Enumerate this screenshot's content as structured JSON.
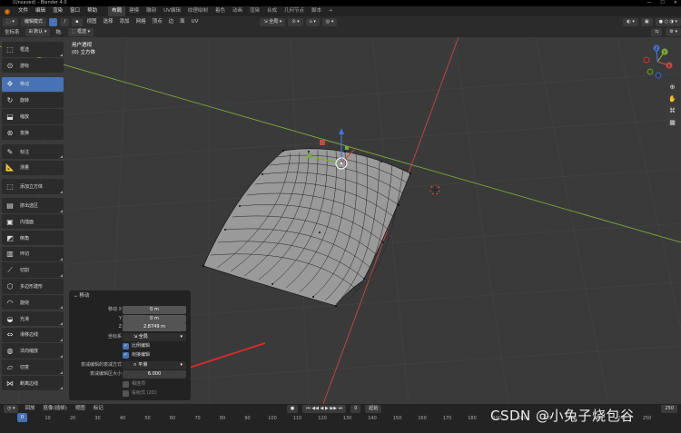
{
  "window": {
    "title": "(Unsaved) - Blender 4.0",
    "controls": [
      "—",
      "☐",
      "✕"
    ]
  },
  "menubar": {
    "menus": [
      "文件",
      "编辑",
      "渲染",
      "窗口",
      "帮助"
    ],
    "workspace_tabs": [
      "布局",
      "建模",
      "雕刻",
      "UV编辑",
      "纹理绘制",
      "着色",
      "动画",
      "渲染",
      "合成",
      "几何节点",
      "脚本",
      "+"
    ],
    "active_tab_index": 0
  },
  "header": {
    "mode": "编辑模式",
    "menus": [
      "视图",
      "选择",
      "添加",
      "网格",
      "顶点",
      "边",
      "面",
      "UV"
    ],
    "transform_orientation": "全局"
  },
  "subheader": {
    "orientation_label": "坐标系",
    "orientation_value": "默认",
    "drag_label": "拖.",
    "drag_value": "框选"
  },
  "toolbar": {
    "tools": [
      {
        "label": "框选",
        "icon": "select-box-icon"
      },
      {
        "label": "游标",
        "icon": "cursor-icon"
      },
      {
        "label": "移动",
        "icon": "move-icon",
        "active": true
      },
      {
        "label": "旋转",
        "icon": "rotate-icon"
      },
      {
        "label": "缩放",
        "icon": "scale-icon"
      },
      {
        "label": "变换",
        "icon": "transform-icon"
      },
      {
        "label": "标注",
        "icon": "annotate-icon"
      },
      {
        "label": "测量",
        "icon": "measure-icon"
      },
      {
        "label": "添加立方体",
        "icon": "add-cube-icon"
      },
      {
        "label": "挤出选区",
        "icon": "extrude-icon"
      },
      {
        "label": "内插面",
        "icon": "inset-icon"
      },
      {
        "label": "倒角",
        "icon": "bevel-icon"
      },
      {
        "label": "环切",
        "icon": "loop-cut-icon"
      },
      {
        "label": "切割",
        "icon": "knife-icon"
      },
      {
        "label": "多边形建形",
        "icon": "poly-build-icon"
      },
      {
        "label": "旋绕",
        "icon": "spin-icon"
      },
      {
        "label": "光滑",
        "icon": "smooth-icon"
      },
      {
        "label": "滑移边线",
        "icon": "edge-slide-icon"
      },
      {
        "label": "法向缩放",
        "icon": "shrink-fatten-icon"
      },
      {
        "label": "切变",
        "icon": "shear-icon"
      },
      {
        "label": "断离边线",
        "icon": "rip-icon"
      }
    ]
  },
  "viewport": {
    "view_name": "用户透视",
    "object_name": "(0) 立方体"
  },
  "gizmo_axes": [
    "X",
    "Y",
    "Z"
  ],
  "operator_panel": {
    "title": "移动",
    "move_x_label": "移动 X",
    "move_x": "0 m",
    "move_y_label": "Y",
    "move_y": "0 m",
    "move_z_label": "Z",
    "move_z": "2.8749 m",
    "orientation_label": "坐标系",
    "orientation_value": "全局",
    "proportional_editing": "比例编辑",
    "connected_only": "衔接编辑",
    "falloff_label": "衰减编辑的衰减方式",
    "falloff_value": "平滑",
    "size_label": "衰减编辑区大小",
    "size_value": "6.000",
    "projected_label": "相连项",
    "projected2_label": "投射式 (2D)"
  },
  "timeline": {
    "menus": [
      "回放",
      "抠像(插帧)",
      "视图",
      "标记"
    ],
    "current_frame": "0",
    "ticks": [
      "0",
      "10",
      "20",
      "30",
      "40",
      "50",
      "60",
      "70",
      "80",
      "90",
      "100",
      "110",
      "120",
      "130",
      "140",
      "150",
      "160",
      "170",
      "180",
      "190",
      "200",
      "210",
      "220",
      "230",
      "240",
      "250"
    ],
    "start_label": "起始",
    "end_value": "250"
  },
  "watermark": "CSDN @小兔子烧包谷",
  "colors": {
    "accent": "#4772b3",
    "x_axis": "#d04747",
    "y_axis": "#80b33d",
    "z_axis": "#4772d0"
  }
}
